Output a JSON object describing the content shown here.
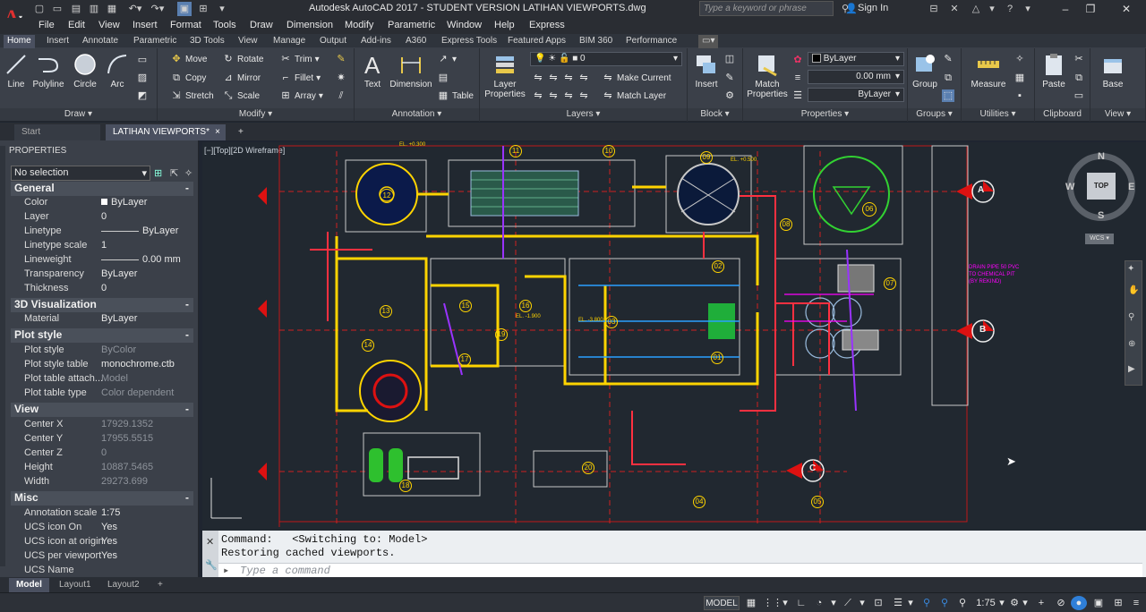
{
  "titlebar": {
    "title": "Autodesk AutoCAD 2017 - STUDENT VERSION    LATIHAN VIEWPORTS.dwg",
    "search_placeholder": "Type a keyword or phrase",
    "sign_in": "Sign In"
  },
  "menus": [
    "File",
    "Edit",
    "View",
    "Insert",
    "Format",
    "Tools",
    "Draw",
    "Dimension",
    "Modify",
    "Parametric",
    "Window",
    "Help",
    "Express"
  ],
  "ribbon_tabs": [
    "Home",
    "Insert",
    "Annotate",
    "Parametric",
    "3D Tools",
    "View",
    "Manage",
    "Output",
    "Add-ins",
    "A360",
    "Express Tools",
    "Featured Apps",
    "BIM 360",
    "Performance"
  ],
  "ribbon": {
    "draw": {
      "title": "Draw",
      "line": "Line",
      "polyline": "Polyline",
      "circle": "Circle",
      "arc": "Arc"
    },
    "modify": {
      "title": "Modify",
      "move": "Move",
      "rotate": "Rotate",
      "trim": "Trim",
      "copy": "Copy",
      "mirror": "Mirror",
      "fillet": "Fillet",
      "stretch": "Stretch",
      "scale": "Scale",
      "array": "Array"
    },
    "annotation": {
      "title": "Annotation",
      "text": "Text",
      "dimension": "Dimension",
      "table": "Table"
    },
    "layers": {
      "title": "Layers",
      "layer_properties_1": "Layer",
      "layer_properties_2": "Properties",
      "layer_value": "0",
      "make_current": "Make Current",
      "match_layer": "Match Layer"
    },
    "block": {
      "title": "Block",
      "insert": "Insert"
    },
    "properties": {
      "title": "Properties",
      "match_1": "Match",
      "match_2": "Properties",
      "color": "ByLayer",
      "lineweight": "0.00 mm",
      "linetype": "ByLayer"
    },
    "groups": {
      "title": "Groups",
      "group": "Group"
    },
    "utilities": {
      "title": "Utilities",
      "measure": "Measure"
    },
    "clipboard": {
      "title": "Clipboard",
      "paste": "Paste"
    },
    "view": {
      "title": "View",
      "base": "Base"
    }
  },
  "doc_tabs": {
    "start": "Start",
    "active": "LATIHAN VIEWPORTS*"
  },
  "properties_panel": {
    "header": "PROPERTIES",
    "selection": "No selection",
    "sections": [
      {
        "name": "General",
        "rows": [
          [
            "Color",
            "ByLayer"
          ],
          [
            "Layer",
            "0"
          ],
          [
            "Linetype",
            "ByLayer"
          ],
          [
            "Linetype scale",
            "1"
          ],
          [
            "Lineweight",
            "0.00 mm"
          ],
          [
            "Transparency",
            "ByLayer"
          ],
          [
            "Thickness",
            "0"
          ]
        ]
      },
      {
        "name": "3D Visualization",
        "rows": [
          [
            "Material",
            "ByLayer"
          ]
        ]
      },
      {
        "name": "Plot style",
        "rows": [
          [
            "Plot style",
            "ByColor"
          ],
          [
            "Plot style table",
            "monochrome.ctb"
          ],
          [
            "Plot table attach...",
            "Model"
          ],
          [
            "Plot table type",
            "Color dependent"
          ]
        ]
      },
      {
        "name": "View",
        "rows": [
          [
            "Center X",
            "17929.1352"
          ],
          [
            "Center Y",
            "17955.5515"
          ],
          [
            "Center Z",
            "0"
          ],
          [
            "Height",
            "10887.5465"
          ],
          [
            "Width",
            "29273.699"
          ]
        ]
      },
      {
        "name": "Misc",
        "rows": [
          [
            "Annotation scale",
            "1:75"
          ],
          [
            "UCS icon On",
            "Yes"
          ],
          [
            "UCS icon at origin",
            "Yes"
          ],
          [
            "UCS per viewport",
            "Yes"
          ],
          [
            "UCS Name",
            ""
          ]
        ]
      }
    ]
  },
  "viewport": {
    "label": "[−][Top][2D Wireframe]",
    "viewcube_top": "TOP",
    "compass": {
      "n": "N",
      "s": "S",
      "e": "E",
      "w": "W"
    },
    "ucs": "WCS",
    "grid_labels": [
      "A",
      "B",
      "C"
    ],
    "equipment": [
      "12",
      "10",
      "11",
      "09",
      "08",
      "06",
      "07",
      "02",
      "13",
      "15",
      "16",
      "14",
      "17",
      "19",
      "03",
      "01",
      "18",
      "20",
      "04",
      "05"
    ],
    "annotation_text": [
      "DRAIN PIPE 50 PVC",
      "TO CHEMICAL PIT",
      "(BY REKIND)"
    ],
    "el_labels": [
      "EL. +0.300",
      "EL. +0.500",
      "EL. -1.900",
      "EL. -3.800"
    ]
  },
  "command": {
    "line1": "Command:   <Switching to: Model>",
    "line2": "Restoring cached viewports.",
    "placeholder": "Type a command"
  },
  "layout_tabs": [
    "Model",
    "Layout1",
    "Layout2"
  ],
  "statusbar": {
    "model": "MODEL",
    "scale": "1:75"
  },
  "colors": {
    "background": "#212830",
    "ribbon": "#3b4049",
    "accent": "#e03030"
  }
}
